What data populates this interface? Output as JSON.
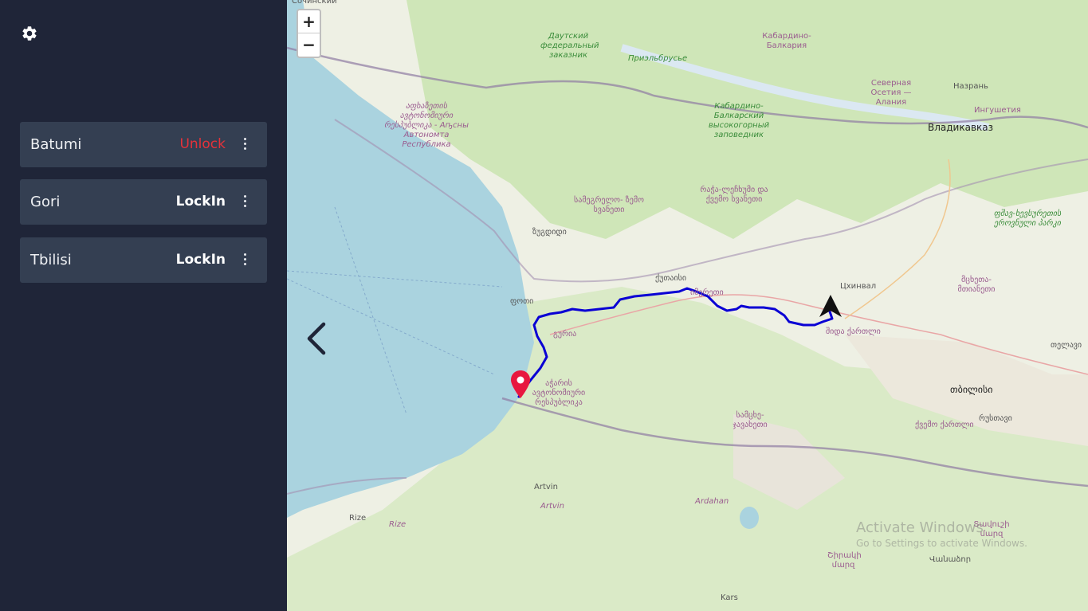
{
  "sidebar": {
    "settings_icon": "gear-icon",
    "routes": [
      {
        "name": "Batumi",
        "action": "Unlock",
        "action_color": "#e5323a",
        "menu_icon": "more-vertical-icon"
      },
      {
        "name": "Gori",
        "action": "LockIn",
        "action_color": "#ffffff",
        "menu_icon": "more-vertical-icon"
      },
      {
        "name": "Tbilisi",
        "action": "LockIn",
        "action_color": "#ffffff",
        "menu_icon": "more-vertical-icon"
      }
    ]
  },
  "map": {
    "zoom_in": "+",
    "zoom_out": "−",
    "back_icon": "chevron-left-icon",
    "route_color": "#0a00d4",
    "marker_color": "#e8173f",
    "labels": {
      "sochi": "Сочинский",
      "dautsky": "Даутский федеральный заказник",
      "kbr": "Кабардино- Балкария",
      "prielbrusye": "Приэльбрусье",
      "abkhazia": "აფხაზეთის ავტონომიური რესპუბლიკა - Аҧсны Автономта Республика",
      "kbr_reserve": "Кабардино- Балкарский высокогорный заповедник",
      "north_ossetia": "Северная Осетия — Алания",
      "nazran": "Назрань",
      "ingushetia": "Ингушетия",
      "vladikavkaz": "Владикавказ",
      "samegrelo": "სამეგრელო- ზემო სვანეთი",
      "racha": "რაჭა-ლეჩხუმი და ქვემო სვანეთი",
      "pshav": "ფშავ-ხევსურეთის ეროვნული პარკი",
      "zugdidi": "ზუგდიდი",
      "kutaisi": "ქუთაისი",
      "imereti": "იმერეთი",
      "tskhinval": "Цхинвал",
      "mtskheta": "მცხეთა- მთიანეთი",
      "poti": "ფოთი",
      "guria": "გურია",
      "shida_kartli": "შიდა ქართლი",
      "telavi": "თელავი",
      "adjara": "აჭარის ავტონომიური რესპუბლიკა",
      "tbilisi": "თბილისი",
      "rustavi": "რუსთავი",
      "samtskhe": "სამცხე- ჯავახეთი",
      "kvemo_kartli": "ქვემო ქართლი",
      "artvin1": "Artvin",
      "artvin2": "Artvin",
      "ardahan": "Ardahan",
      "rize1": "Rize",
      "rize2": "Rize",
      "shirak": "Շիրակի մարզ",
      "tavush": "Տավուշի մարզ",
      "vanadzor": "Վանաձոր",
      "kars": "Kars"
    },
    "watermark": {
      "line1": "Activate Windows",
      "line2": "Go to Settings to activate Windows."
    }
  }
}
